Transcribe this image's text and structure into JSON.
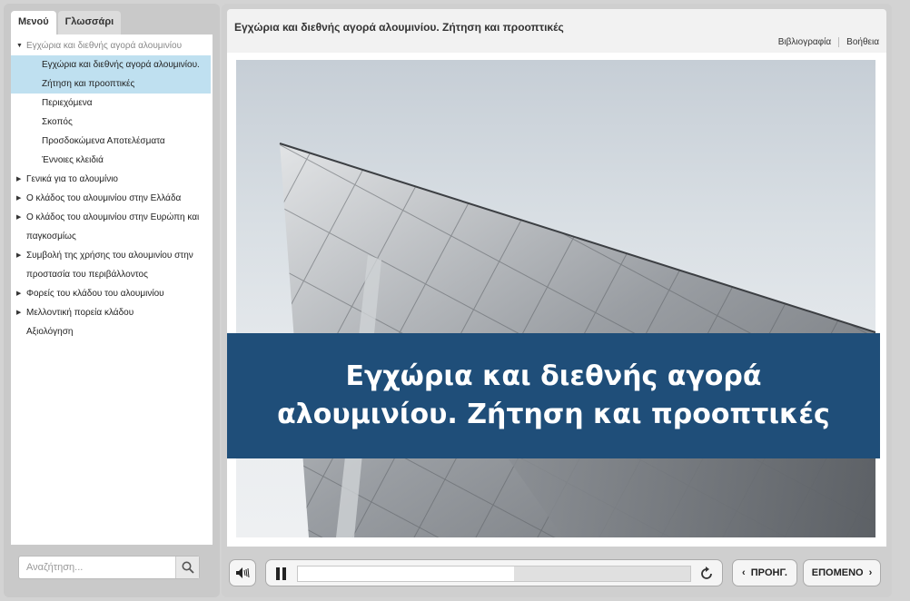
{
  "tabs": {
    "menu": "Μενού",
    "glossary": "Γλωσσάρι"
  },
  "menu": {
    "items": [
      {
        "label": "Εγχώρια και διεθνής αγορά αλουμινίου"
      },
      {
        "label": "Εγχώρια και διεθνής αγορά αλουμινίου."
      },
      {
        "label": "Ζήτηση και προοπτικές"
      },
      {
        "label": "Περιεχόμενα"
      },
      {
        "label": "Σκοπός"
      },
      {
        "label": "Προσδοκώμενα Αποτελέσματα"
      },
      {
        "label": "Έννοιες κλειδιά"
      },
      {
        "label": "Γενικά για το αλουμίνιο"
      },
      {
        "label": "Ο κλάδος του αλουμινίου στην Ελλάδα"
      },
      {
        "label": "Ο κλάδος του αλουμινίου στην Ευρώπη και"
      },
      {
        "label": "παγκοσμίως"
      },
      {
        "label": "Συμβολή της χρήσης του αλουμινίου στην"
      },
      {
        "label": "προστασία του περιβάλλοντος"
      },
      {
        "label": "Φορείς του κλάδου του αλουμινίου"
      },
      {
        "label": "Μελλοντική πορεία κλάδου"
      },
      {
        "label": "Αξιολόγηση"
      }
    ]
  },
  "search": {
    "placeholder": "Αναζήτηση..."
  },
  "header": {
    "title": "Εγχώρια και διεθνής αγορά αλουμινίου. Ζήτηση και προοπτικές",
    "bibliography": "Βιβλιογραφία",
    "help": "Βοήθεια"
  },
  "slide": {
    "title": "Εγχώρια και διεθνής αγορά αλουμινίου. Ζήτηση και προοπτικές"
  },
  "player": {
    "progress_fraction": 0.55
  },
  "nav": {
    "prev": "ΠΡΟΗΓ.",
    "next": "ΕΠΟΜΕΝΟ"
  },
  "colors": {
    "banner": "#1f4e79",
    "selected": "#bfe0f0"
  }
}
